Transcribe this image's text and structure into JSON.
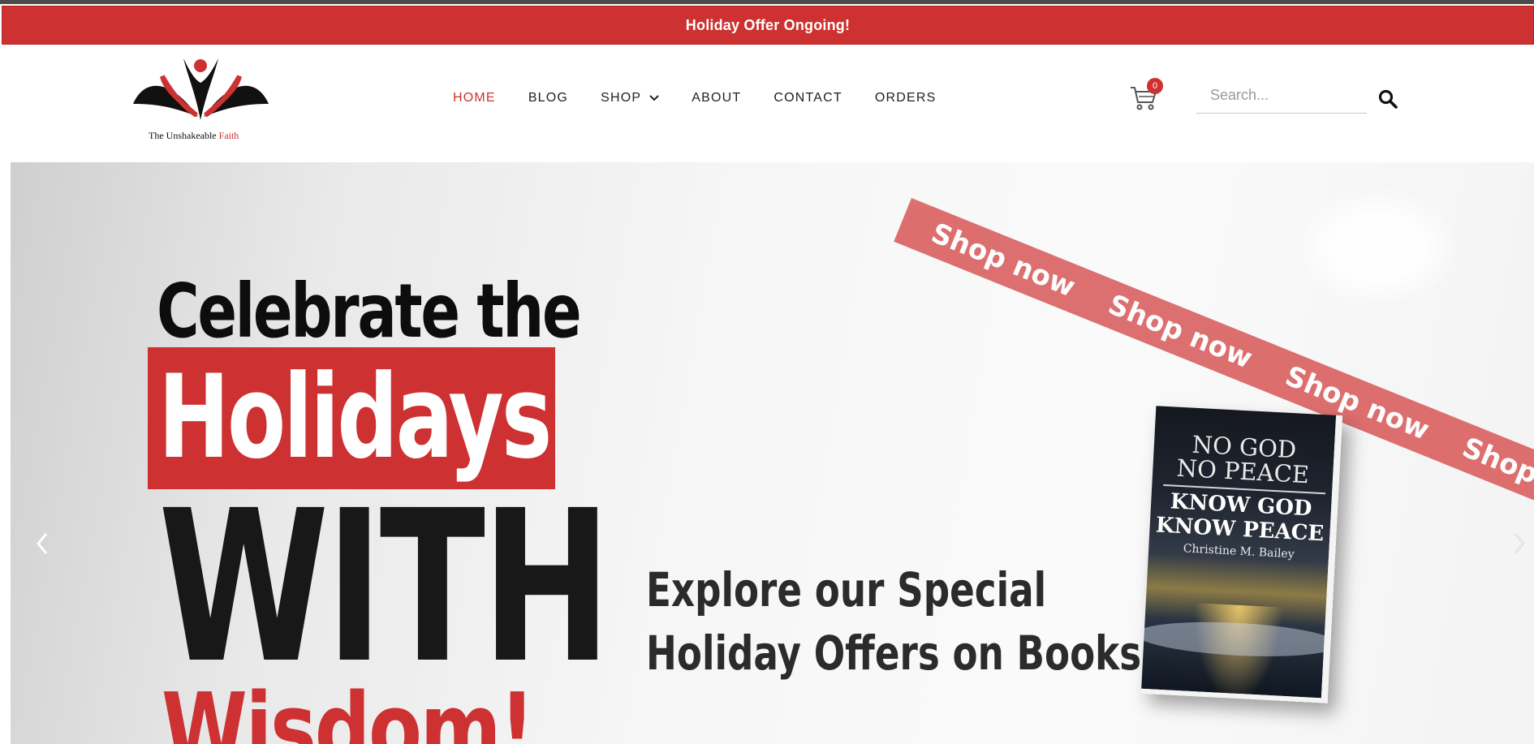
{
  "announcement": {
    "text": "Holiday Offer Ongoing!"
  },
  "logo": {
    "name": "The Unshakeable",
    "accent": "Faith"
  },
  "nav": {
    "items": [
      {
        "label": "HOME"
      },
      {
        "label": "BLOG"
      },
      {
        "label": "SHOP"
      },
      {
        "label": "ABOUT"
      },
      {
        "label": "CONTACT"
      },
      {
        "label": "ORDERS"
      }
    ]
  },
  "cart": {
    "count": "0"
  },
  "search": {
    "placeholder": "Search..."
  },
  "hero": {
    "headline_1": "Celebrate the",
    "headline_2": "Holidays",
    "headline_3": "WITH",
    "headline_4": "Wisdom!",
    "subtext_1": "Explore our Special",
    "subtext_2": "Holiday Offers on Books.",
    "ribbon": "Shop now",
    "book": {
      "title_1": "NO GOD",
      "title_2": "NO PEACE",
      "subtitle_1": "KNOW GOD",
      "subtitle_2": "KNOW PEACE",
      "author": "Christine M. Bailey"
    }
  },
  "colors": {
    "accent": "#cd3131",
    "text": "#222222"
  }
}
